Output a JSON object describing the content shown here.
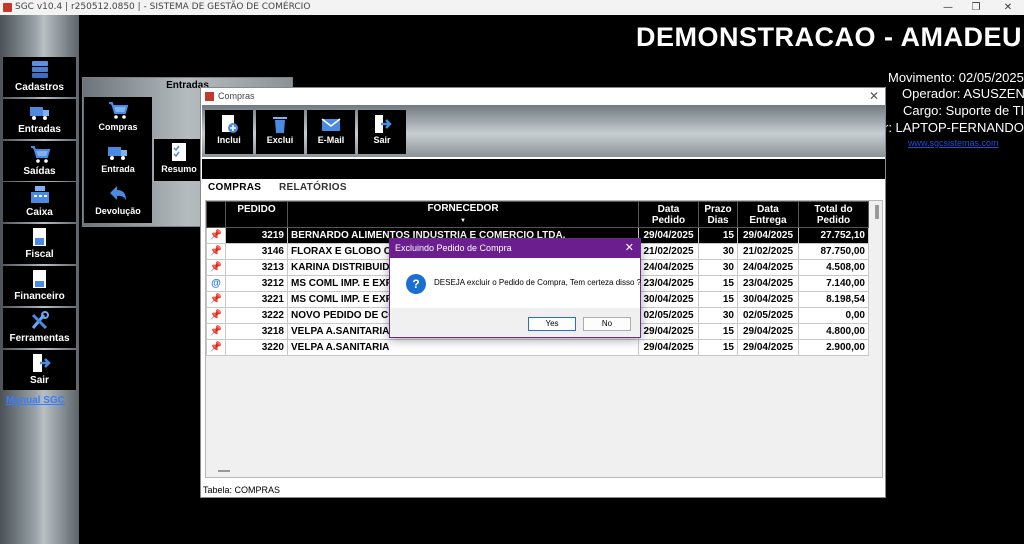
{
  "titlebar": {
    "title": "SGC v10.4 | r250512.0850 | - SISTEMA DE GESTÃO DE COMÉRCIO",
    "minimize": "—",
    "restore": "❐",
    "close": "✕"
  },
  "header": {
    "company": "DEMONSTRACAO - AMADEU",
    "movimento": "Movimento: 02/05/2025",
    "operador": "Operador: ASUSZEN",
    "cargo": "Cargo: Suporte de TI",
    "computador": "r: LAPTOP-FERNANDO",
    "site": "www.sgcsistemas.com"
  },
  "sidebar": {
    "items": [
      {
        "label": "Cadastros",
        "icon": "database-icon"
      },
      {
        "label": "Entradas",
        "icon": "truck-icon"
      },
      {
        "label": "Saídas",
        "icon": "cart-icon"
      },
      {
        "label": "Caixa",
        "icon": "cash-register-icon"
      },
      {
        "label": "Fiscal",
        "icon": "document-icon"
      },
      {
        "label": "Financeiro",
        "icon": "report-icon"
      },
      {
        "label": "Ferramentas",
        "icon": "tools-icon"
      },
      {
        "label": "Sair",
        "icon": "exit-icon"
      }
    ],
    "manual_link": "Manual SGC"
  },
  "entradas_menu": {
    "title": "Entradas",
    "items": [
      {
        "label": "Compras",
        "icon": "cart-icon"
      },
      {
        "label": "Entrada",
        "icon": "truck-icon"
      },
      {
        "label": "Resumo",
        "icon": "checklist-icon"
      },
      {
        "label": "Devolução",
        "icon": "return-arrow-icon"
      }
    ]
  },
  "compras_window": {
    "title": "Compras",
    "close": "✕",
    "toolbar": [
      {
        "label": "Inclui",
        "icon": "new-document-icon"
      },
      {
        "label": "Exclui",
        "icon": "trash-icon"
      },
      {
        "label": "E-Mail",
        "icon": "email-icon"
      },
      {
        "label": "Sair",
        "icon": "exit-icon"
      }
    ],
    "tabs": [
      {
        "label": "COMPRAS",
        "active": true
      },
      {
        "label": "RELATÓRIOS",
        "active": false
      }
    ],
    "columns": {
      "pedido": "PEDIDO",
      "fornecedor": "FORNECEDOR",
      "sort_mark": "▼",
      "data_pedido_1": "Data",
      "data_pedido_2": "Pedido",
      "prazo_1": "Prazo",
      "prazo_2": "Dias",
      "data_entrega_1": "Data",
      "data_entrega_2": "Entrega",
      "total_1": "Total do",
      "total_2": "Pedido"
    },
    "rows": [
      {
        "icon": "pin-icon",
        "glyph": "📌",
        "pedido": "3219",
        "fornecedor": "BERNARDO ALIMENTOS INDUSTRIA E COMERCIO LTDA.",
        "data_pedido": "29/04/2025",
        "prazo": "15",
        "data_entrega": "29/04/2025",
        "total": "27.752,10"
      },
      {
        "icon": "pin-icon",
        "glyph": "📌",
        "pedido": "3146",
        "fornecedor": "FLORAX E GLOBO CO",
        "data_pedido": "21/02/2025",
        "prazo": "30",
        "data_entrega": "21/02/2025",
        "total": "87.750,00"
      },
      {
        "icon": "pin-icon",
        "glyph": "📌",
        "pedido": "3213",
        "fornecedor": "KARINA DISTRIBUIDO",
        "data_pedido": "24/04/2025",
        "prazo": "30",
        "data_entrega": "24/04/2025",
        "total": "4.508,00"
      },
      {
        "icon": "at-sign-icon",
        "glyph": "@",
        "pedido": "3212",
        "fornecedor": "MS COML IMP. E EXP",
        "data_pedido": "23/04/2025",
        "prazo": "15",
        "data_entrega": "23/04/2025",
        "total": "7.140,00"
      },
      {
        "icon": "pin-icon",
        "glyph": "📌",
        "pedido": "3221",
        "fornecedor": "MS COML IMP. E EXP",
        "data_pedido": "30/04/2025",
        "prazo": "15",
        "data_entrega": "30/04/2025",
        "total": "8.198,54"
      },
      {
        "icon": "pin-icon",
        "glyph": "📌",
        "pedido": "3222",
        "fornecedor": "NOVO PEDIDO DE CO",
        "data_pedido": "02/05/2025",
        "prazo": "30",
        "data_entrega": "02/05/2025",
        "total": "0,00"
      },
      {
        "icon": "pin-icon",
        "glyph": "📌",
        "pedido": "3218",
        "fornecedor": "VELPA A.SANITARIA",
        "data_pedido": "29/04/2025",
        "prazo": "15",
        "data_entrega": "29/04/2025",
        "total": "4.800,00"
      },
      {
        "icon": "pin-icon",
        "glyph": "📌",
        "pedido": "3220",
        "fornecedor": "VELPA A.SANITARIA",
        "data_pedido": "29/04/2025",
        "prazo": "15",
        "data_entrega": "29/04/2025",
        "total": "2.900,00"
      }
    ],
    "selected_row": 0,
    "status": "Tabela: COMPRAS"
  },
  "dialog": {
    "title": "Excluindo Pedido de Compra",
    "close": "✕",
    "icon": "question-icon",
    "icon_glyph": "?",
    "message": "DESEJA excluir o Pedido de Compra, Tem certeza disso ?",
    "yes": "Yes",
    "no": "No"
  },
  "colors": {
    "dialog_title": "#6b1f8e",
    "link": "#3a7cff",
    "pin": "#dd0000"
  }
}
